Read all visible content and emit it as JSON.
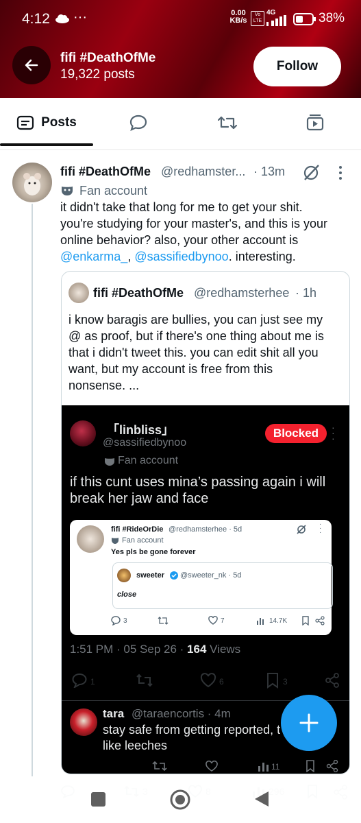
{
  "status_bar": {
    "time": "4:12",
    "net_speed": "0.00",
    "net_unit": "KB/s",
    "volte": "Vo LTE",
    "net_type": "4G",
    "battery": "38%"
  },
  "header": {
    "title": "fifi #DeathOfMe",
    "subtitle": "19,322 posts",
    "follow_label": "Follow"
  },
  "tabs": {
    "posts_label": "Posts"
  },
  "tweet": {
    "name": "fifi #DeathOfMe",
    "handle": "@redhamster...",
    "time": "· 13m",
    "label": "Fan account",
    "text_1": "it didn't take that long for me to get your shit.",
    "text_2": "you're studying for your master's, and this is your",
    "text_3": "online behavior? also, your other account is",
    "mention_1": "@enkarma_",
    "sep": ", ",
    "mention_2": "@sassifiedbynoo",
    "text_4": ". interesting."
  },
  "quote": {
    "name": "fifi #DeathOfMe",
    "handle": "@redhamsterhee",
    "time": "· 1h",
    "lines": [
      "i know baragis are bullies, you can just see my",
      "@ as proof, but if there's one thing about me is",
      "that i didn't tweet this. you can edit shit all you",
      "want, but my account is free from this",
      "nonsense. ..."
    ]
  },
  "screenshot": {
    "name": "「linbliss」",
    "handle": "@sassifiedbynoo",
    "blocked_label": "Blocked",
    "label": "Fan account",
    "text_1": "if this cunt uses mina’s passing again i will",
    "text_2": "break her jaw and face",
    "inner": {
      "name": "fifi #RideOrDie",
      "handle": "@redhamsterhee · 5d",
      "label": "Fan account",
      "text": "Yes pls be gone forever",
      "nested_name": "sweeter",
      "nested_handle": "@sweeter_nk · 5d",
      "nested_text": "close",
      "replies": "3",
      "likes": "7",
      "views": "14.7K"
    },
    "meta_time": "1:51 PM · 05 Sep 26 · ",
    "meta_views_count": "164",
    "meta_views_label": " Views",
    "replies": "1",
    "likes": "6",
    "bookmarks": "3",
    "reply_name": "tara",
    "reply_handle": "@taraencortis · 4m",
    "reply_text_1": "stay safe from getting reported, t",
    "reply_text_2": "like leeches",
    "reply_views": "11"
  },
  "footer_faded": {
    "retweets": "3",
    "likes": "8",
    "views": "296"
  },
  "colors": {
    "accent": "#1d9bf0",
    "blocked": "#f4212e",
    "header_red": "#9a0010"
  }
}
